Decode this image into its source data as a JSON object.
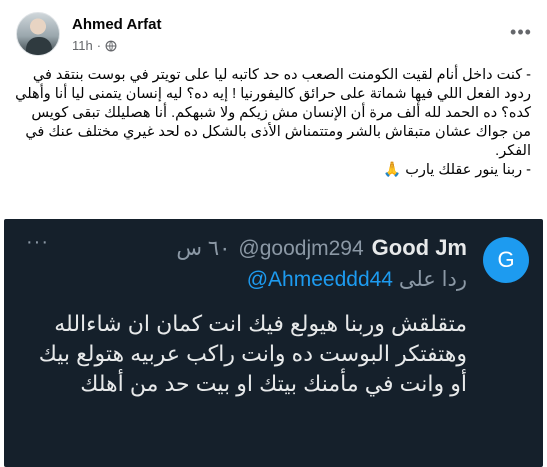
{
  "post": {
    "author": "Ahmed Arfat",
    "time": "11h",
    "audience_icon": "globe-icon",
    "more_icon": "more-options-icon",
    "paragraphs": [
      "- كنت داخل أنام لقيت الكومنت الصعب ده حد كاتبه ليا على تويتر في بوست بنتقد في ردود الفعل اللي فيها شماتة على حرائق كاليفورنيا ! إيه ده؟ ليه إنسان يتمنى ليا أنا وأهلي كده؟ ده الحمد لله ألف مرة أن الإنسان مش زيكم ولا شبهكم. أنا هصليلك تبقى كويس من جواك عشان متبقاش بالشر ومتتمناش الأذى بالشكل ده لحد غيري مختلف عنك في الفكر.",
      "- ربنا ينور عقلك يارب 🙏"
    ]
  },
  "tweet": {
    "avatar_letter": "G",
    "display_name": "Good Jm",
    "handle": "@goodjm294",
    "time": "٦٠ س",
    "reply_label": "ردا على",
    "reply_to": "@Ahmeeddd44",
    "body": "متقلقش وربنا هيولع فيك انت كمان ان شاءالله وهتفتكر البوست ده وانت راكب عربيه هتولع بيك أو وانت في مأمنك بيتك او بيت حد من أهلك",
    "more_icon": "more-options-icon"
  },
  "colors": {
    "embed_background": "#15202b",
    "tweet_link": "#1d9bf0",
    "tweet_text": "#e7e9ea",
    "tweet_muted": "#8b98a5"
  }
}
